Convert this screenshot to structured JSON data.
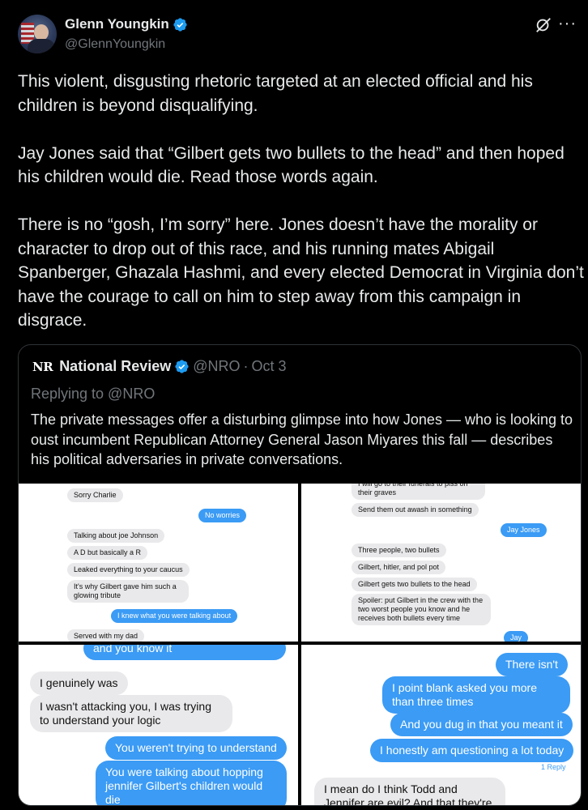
{
  "author": {
    "name": "Glenn Youngkin",
    "handle": "@GlennYoungkin",
    "verified_color": "#1d9bf0"
  },
  "icons": {
    "grok": "grok-icon",
    "more": "more-icon",
    "verified": "verified-badge-icon"
  },
  "more_glyph": "···",
  "tweet": {
    "paragraphs": [
      "This violent, disgusting rhetoric targeted at an elected official and his children is beyond disqualifying.",
      "Jay Jones said that “Gilbert gets two bullets to the head” and then hoped his children would die. Read those words again.",
      "There is no “gosh, I’m sorry” here. Jones doesn’t have the morality or character to drop out of this race, and his running mates Abigail Spanberger, Ghazala Hashmi, and every elected Democrat in Virginia don’t have the courage to call on him to step away from this campaign in disgrace."
    ]
  },
  "quoted": {
    "logo": "NR",
    "name": "National Review",
    "handle": "@NRO",
    "separator": "·",
    "date": "Oct 3",
    "replying_to": "Replying to @NRO",
    "text": "The private messages offer a disturbing glimpse into how Jones — who is looking to oust incumbent Republican Attorney General Jason Miyares this fall — describes his political adversaries in private conversations.",
    "images": {
      "panel1": [
        "Sorry Charlie",
        "No worries",
        "Talking about joe Johnson",
        "A D but basically a R",
        "Leaked everything to your caucus",
        "It's why Gilbert gave him such a glowing tribute",
        "I knew what you were talking about",
        "Served with my dad"
      ],
      "panel2": [
        "I will go to their funerals to piss on their graves",
        "Send them out awash in something",
        "Jay Jones",
        "Three people, two bullets",
        "Gilbert, hitler, and pol pot",
        "Gilbert gets two bullets to the head",
        "Spoiler: put Gilbert in the crew with the two worst people you know and he receives both bullets every time",
        "Jay"
      ],
      "panel3": [
        "and you know it",
        "I genuinely was",
        "I wasn't attacking you, I was trying to understand your logic",
        "You weren't trying to understand",
        "You were talking about hopping jennifer Gilbert's children would die"
      ],
      "panel4": [
        "There isn't",
        "I point blank asked you more than three times",
        "And you dug in that you meant it",
        "I honestly am questioning a lot today",
        "1 Reply",
        "I mean do I think Todd and Jennifer are evil? And that they're breeding"
      ]
    }
  }
}
